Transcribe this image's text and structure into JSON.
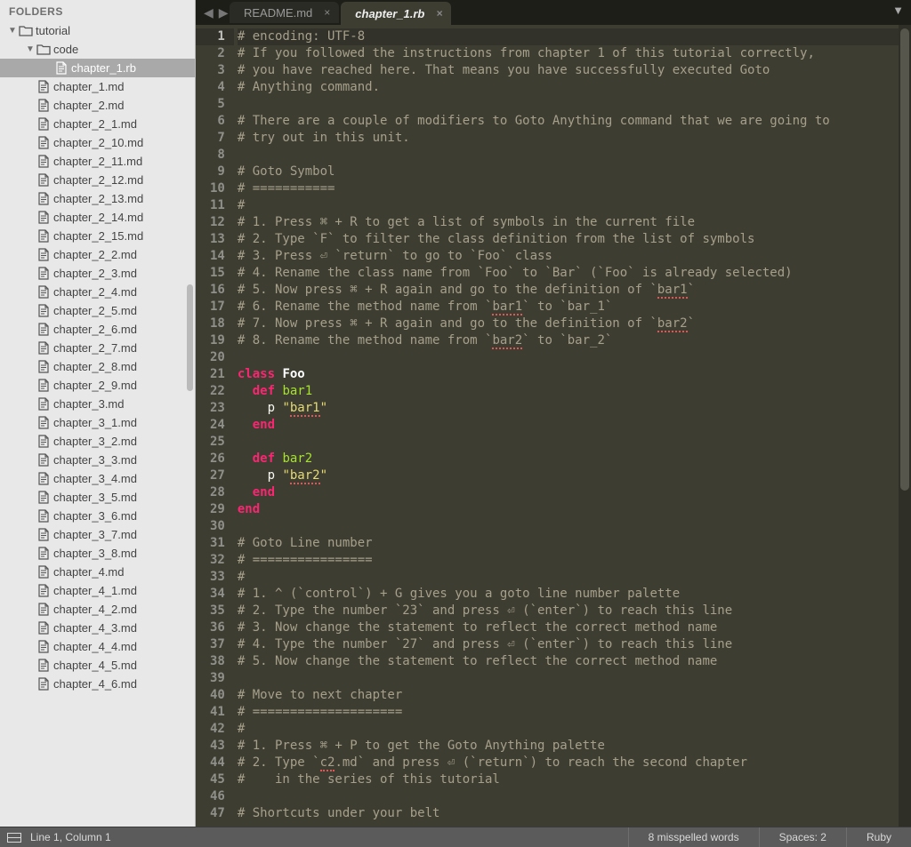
{
  "sidebar": {
    "header": "FOLDERS",
    "items": [
      {
        "label": "tutorial",
        "kind": "folder",
        "indent": 0,
        "expanded": true
      },
      {
        "label": "code",
        "kind": "folder",
        "indent": 1,
        "expanded": true
      },
      {
        "label": "chapter_1.rb",
        "kind": "file",
        "indent": 2,
        "selected": true
      },
      {
        "label": "chapter_1.md",
        "kind": "file",
        "indent": 1
      },
      {
        "label": "chapter_2.md",
        "kind": "file",
        "indent": 1
      },
      {
        "label": "chapter_2_1.md",
        "kind": "file",
        "indent": 1
      },
      {
        "label": "chapter_2_10.md",
        "kind": "file",
        "indent": 1
      },
      {
        "label": "chapter_2_11.md",
        "kind": "file",
        "indent": 1
      },
      {
        "label": "chapter_2_12.md",
        "kind": "file",
        "indent": 1
      },
      {
        "label": "chapter_2_13.md",
        "kind": "file",
        "indent": 1
      },
      {
        "label": "chapter_2_14.md",
        "kind": "file",
        "indent": 1
      },
      {
        "label": "chapter_2_15.md",
        "kind": "file",
        "indent": 1
      },
      {
        "label": "chapter_2_2.md",
        "kind": "file",
        "indent": 1
      },
      {
        "label": "chapter_2_3.md",
        "kind": "file",
        "indent": 1
      },
      {
        "label": "chapter_2_4.md",
        "kind": "file",
        "indent": 1
      },
      {
        "label": "chapter_2_5.md",
        "kind": "file",
        "indent": 1
      },
      {
        "label": "chapter_2_6.md",
        "kind": "file",
        "indent": 1
      },
      {
        "label": "chapter_2_7.md",
        "kind": "file",
        "indent": 1
      },
      {
        "label": "chapter_2_8.md",
        "kind": "file",
        "indent": 1
      },
      {
        "label": "chapter_2_9.md",
        "kind": "file",
        "indent": 1
      },
      {
        "label": "chapter_3.md",
        "kind": "file",
        "indent": 1
      },
      {
        "label": "chapter_3_1.md",
        "kind": "file",
        "indent": 1
      },
      {
        "label": "chapter_3_2.md",
        "kind": "file",
        "indent": 1
      },
      {
        "label": "chapter_3_3.md",
        "kind": "file",
        "indent": 1
      },
      {
        "label": "chapter_3_4.md",
        "kind": "file",
        "indent": 1
      },
      {
        "label": "chapter_3_5.md",
        "kind": "file",
        "indent": 1
      },
      {
        "label": "chapter_3_6.md",
        "kind": "file",
        "indent": 1
      },
      {
        "label": "chapter_3_7.md",
        "kind": "file",
        "indent": 1
      },
      {
        "label": "chapter_3_8.md",
        "kind": "file",
        "indent": 1
      },
      {
        "label": "chapter_4.md",
        "kind": "file",
        "indent": 1
      },
      {
        "label": "chapter_4_1.md",
        "kind": "file",
        "indent": 1
      },
      {
        "label": "chapter_4_2.md",
        "kind": "file",
        "indent": 1
      },
      {
        "label": "chapter_4_3.md",
        "kind": "file",
        "indent": 1
      },
      {
        "label": "chapter_4_4.md",
        "kind": "file",
        "indent": 1
      },
      {
        "label": "chapter_4_5.md",
        "kind": "file",
        "indent": 1
      },
      {
        "label": "chapter_4_6.md",
        "kind": "file",
        "indent": 1
      }
    ]
  },
  "tabs": [
    {
      "label": "README.md",
      "active": false
    },
    {
      "label": "chapter_1.rb",
      "active": true
    }
  ],
  "code": {
    "lines": [
      {
        "t": "comment",
        "text": "# encoding: UTF-8"
      },
      {
        "t": "comment",
        "text": "# If you followed the instructions from chapter 1 of this tutorial correctly,"
      },
      {
        "t": "comment",
        "text": "# you have reached here. That means you have successfully executed Goto"
      },
      {
        "t": "comment",
        "text": "# Anything command."
      },
      {
        "t": "blank",
        "text": ""
      },
      {
        "t": "comment",
        "text": "# There are a couple of modifiers to Goto Anything command that we are going to"
      },
      {
        "t": "comment",
        "text": "# try out in this unit."
      },
      {
        "t": "blank",
        "text": ""
      },
      {
        "t": "comment",
        "text": "# Goto Symbol"
      },
      {
        "t": "comment",
        "text": "# ==========="
      },
      {
        "t": "comment",
        "text": "#"
      },
      {
        "t": "comment",
        "text": "# 1. Press ⌘ + R to get a list of symbols in the current file"
      },
      {
        "t": "comment",
        "text": "# 2. Type `F` to filter the class definition from the list of symbols"
      },
      {
        "t": "comment",
        "text": "# 3. Press ⏎ `return` to go to `Foo` class"
      },
      {
        "t": "comment",
        "text": "# 4. Rename the class name from `Foo` to `Bar` (`Foo` is already selected)"
      },
      {
        "t": "comment",
        "spell": [
          "bar1"
        ],
        "text": "# 5. Now press ⌘ + R again and go to the definition of `bar1`"
      },
      {
        "t": "comment",
        "spell": [
          "bar1"
        ],
        "text": "# 6. Rename the method name from `bar1` to `bar_1`"
      },
      {
        "t": "comment",
        "spell": [
          "bar2"
        ],
        "text": "# 7. Now press ⌘ + R again and go to the definition of `bar2`"
      },
      {
        "t": "comment",
        "spell": [
          "bar2"
        ],
        "text": "# 8. Rename the method name from `bar2` to `bar_2`"
      },
      {
        "t": "blank",
        "text": ""
      },
      {
        "t": "ruby",
        "tokens": [
          [
            "keyword",
            "class"
          ],
          [
            "plain",
            " "
          ],
          [
            "class",
            "Foo"
          ]
        ]
      },
      {
        "t": "ruby",
        "tokens": [
          [
            "plain",
            "  "
          ],
          [
            "keyword",
            "def"
          ],
          [
            "plain",
            " "
          ],
          [
            "def",
            "bar1"
          ]
        ]
      },
      {
        "t": "ruby",
        "tokens": [
          [
            "plain",
            "    "
          ],
          [
            "op",
            "p "
          ],
          [
            "str",
            "\"bar1\""
          ]
        ],
        "spell": [
          "bar1"
        ]
      },
      {
        "t": "ruby",
        "tokens": [
          [
            "plain",
            "  "
          ],
          [
            "keyword",
            "end"
          ]
        ]
      },
      {
        "t": "blank",
        "text": ""
      },
      {
        "t": "ruby",
        "tokens": [
          [
            "plain",
            "  "
          ],
          [
            "keyword",
            "def"
          ],
          [
            "plain",
            " "
          ],
          [
            "def",
            "bar2"
          ]
        ]
      },
      {
        "t": "ruby",
        "tokens": [
          [
            "plain",
            "    "
          ],
          [
            "op",
            "p "
          ],
          [
            "str",
            "\"bar2\""
          ]
        ],
        "spell": [
          "bar2"
        ]
      },
      {
        "t": "ruby",
        "tokens": [
          [
            "plain",
            "  "
          ],
          [
            "keyword",
            "end"
          ]
        ]
      },
      {
        "t": "ruby",
        "tokens": [
          [
            "keyword",
            "end"
          ]
        ]
      },
      {
        "t": "blank",
        "text": ""
      },
      {
        "t": "comment",
        "text": "# Goto Line number"
      },
      {
        "t": "comment",
        "text": "# ================"
      },
      {
        "t": "comment",
        "text": "#"
      },
      {
        "t": "comment",
        "text": "# 1. ^ (`control`) + G gives you a goto line number palette"
      },
      {
        "t": "comment",
        "text": "# 2. Type the number `23` and press ⏎ (`enter`) to reach this line"
      },
      {
        "t": "comment",
        "text": "# 3. Now change the statement to reflect the correct method name"
      },
      {
        "t": "comment",
        "text": "# 4. Type the number `27` and press ⏎ (`enter`) to reach this line"
      },
      {
        "t": "comment",
        "text": "# 5. Now change the statement to reflect the correct method name"
      },
      {
        "t": "blank",
        "text": ""
      },
      {
        "t": "comment",
        "text": "# Move to next chapter"
      },
      {
        "t": "comment",
        "text": "# ===================="
      },
      {
        "t": "comment",
        "text": "#"
      },
      {
        "t": "comment",
        "text": "# 1. Press ⌘ + P to get the Goto Anything palette"
      },
      {
        "t": "comment",
        "spell": [
          "c2"
        ],
        "text": "# 2. Type `c2.md` and press ⏎ (`return`) to reach the second chapter"
      },
      {
        "t": "comment",
        "text": "#    in the series of this tutorial"
      },
      {
        "t": "blank",
        "text": ""
      },
      {
        "t": "comment",
        "text": "# Shortcuts under your belt"
      }
    ],
    "active_line": 1
  },
  "status": {
    "position": "Line 1, Column 1",
    "spell": "8 misspelled words",
    "spaces": "Spaces: 2",
    "syntax": "Ruby"
  }
}
